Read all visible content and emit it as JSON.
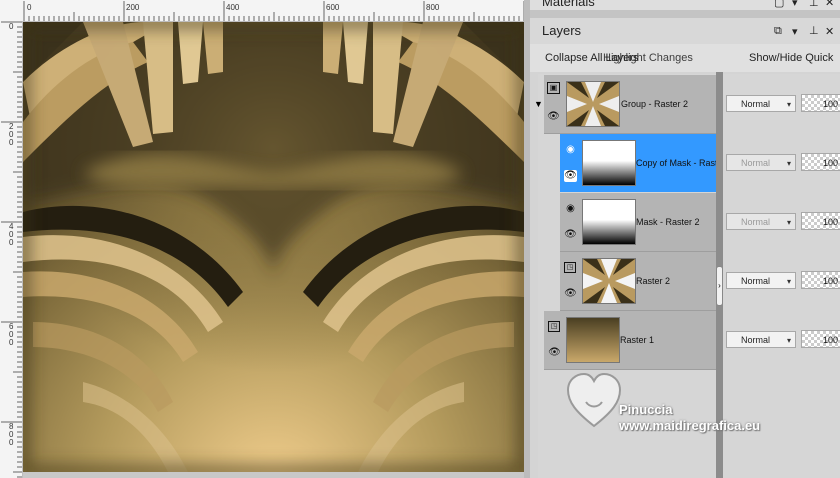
{
  "rulers": {
    "top_labels": [
      "0",
      "200",
      "400",
      "600",
      "800"
    ],
    "left_labels": [
      "0",
      "2\n0\n0",
      "4\n0\n0",
      "6\n0\n0",
      "8\n0\n0"
    ]
  },
  "materials_panel": {
    "title": "Materials"
  },
  "layers_panel": {
    "title": "Layers",
    "toolbar": {
      "collapse_all": "Collapse All Layers",
      "highlight": "Highlight Changes",
      "show_hide": "Show/Hide Quick"
    },
    "rows": [
      {
        "name": "Group - Raster 2",
        "blend": "Normal",
        "opacity": "100",
        "selected": false,
        "icon": "group-icon"
      },
      {
        "name": "Copy of Mask - Raster 2",
        "blend": "Normal",
        "opacity": "100",
        "selected": true,
        "icon": "mask-icon"
      },
      {
        "name": "Mask - Raster 2",
        "blend": "Normal",
        "opacity": "100",
        "selected": false,
        "icon": "mask-icon"
      },
      {
        "name": "Raster 2",
        "blend": "Normal",
        "opacity": "100",
        "selected": false,
        "icon": "raster-icon"
      },
      {
        "name": "Raster 1",
        "blend": "Normal",
        "opacity": "100",
        "selected": false,
        "icon": "raster-icon"
      }
    ]
  },
  "watermark": {
    "line1": "Pinuccia",
    "line2": "www.maidiregrafica.eu"
  },
  "colors": {
    "selection": "#3399ff",
    "canvas_light": "#e8c88a",
    "canvas_dark": "#3d3520",
    "canvas_mid": "#8a7440"
  }
}
